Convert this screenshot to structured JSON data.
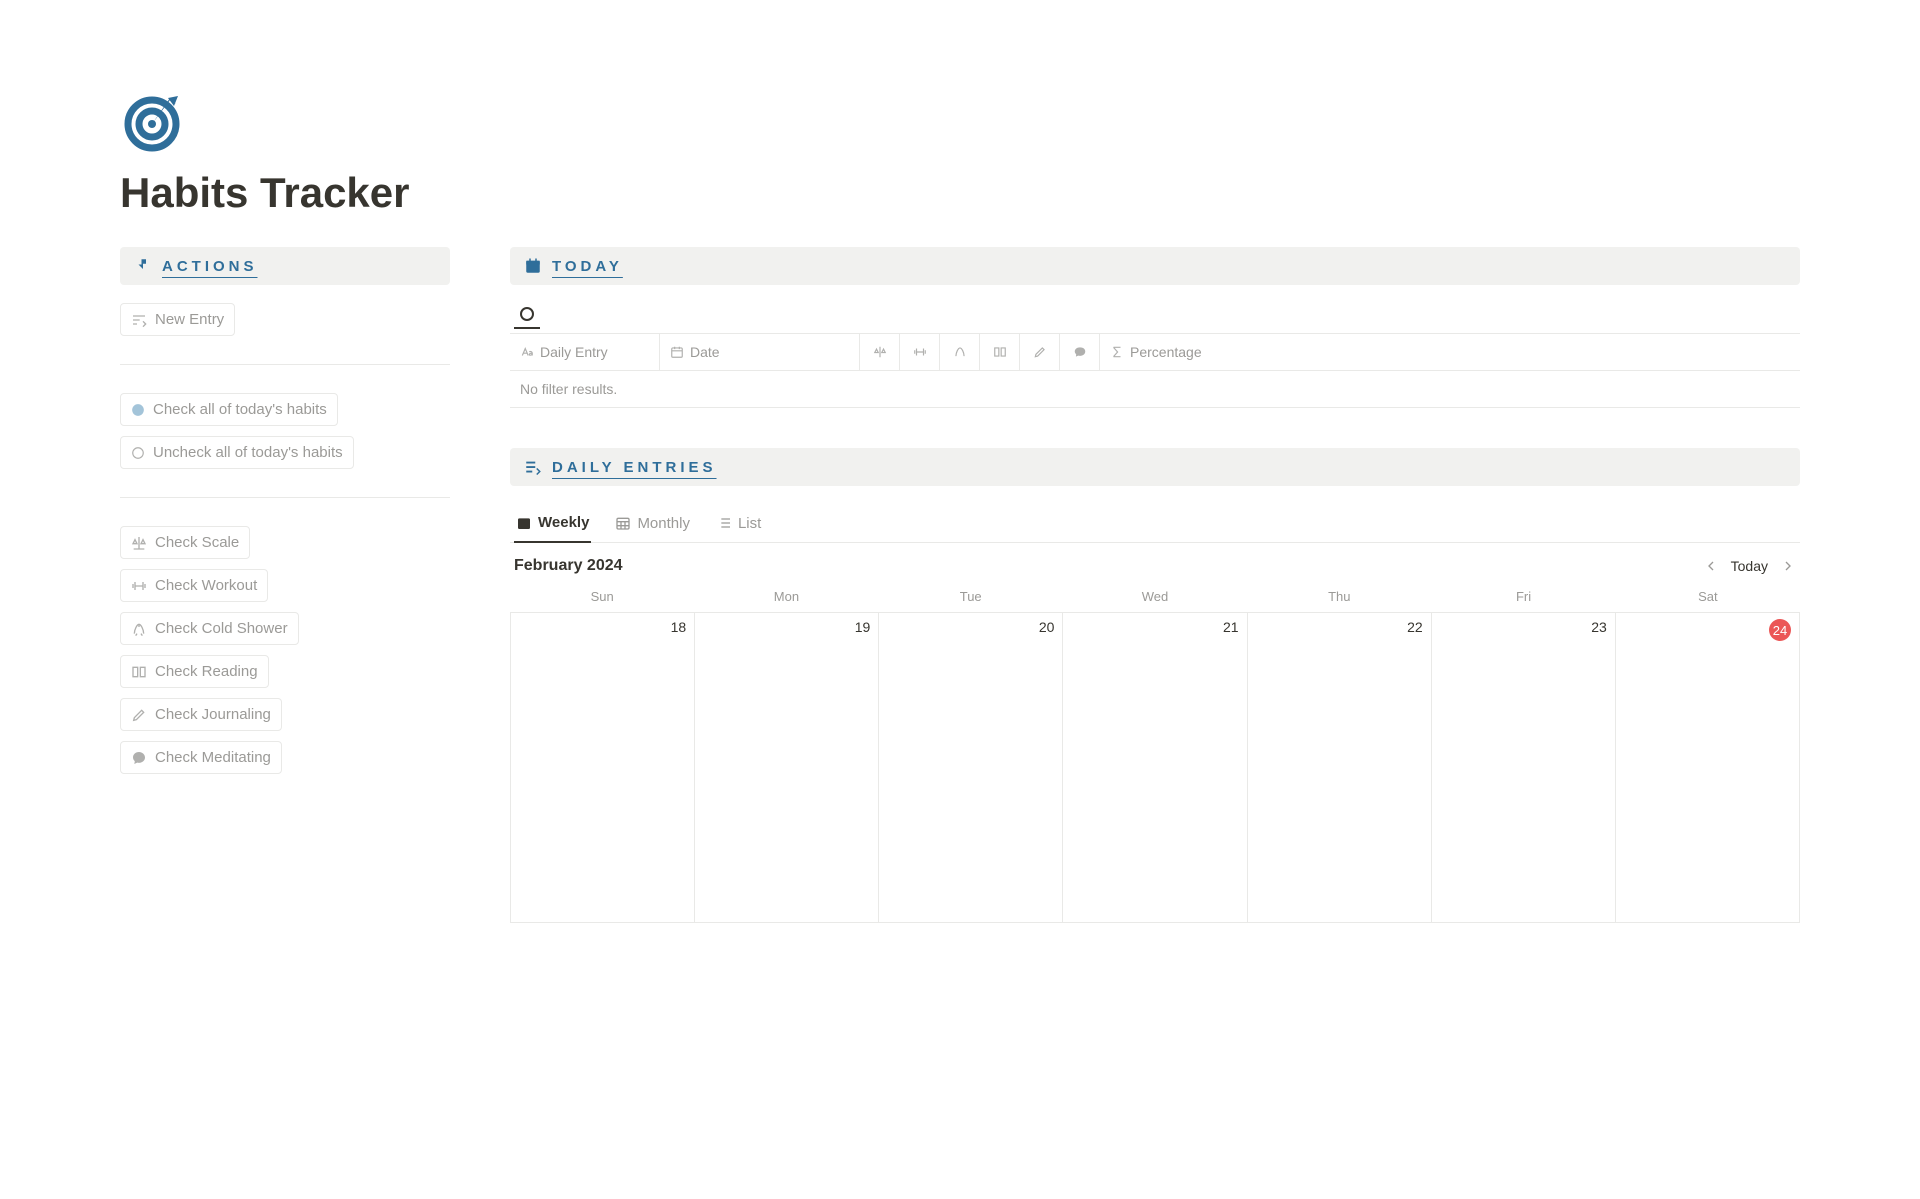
{
  "page": {
    "title": "Habits Tracker"
  },
  "actions": {
    "header": "ACTIONS",
    "new_entry": "New Entry",
    "check_all": "Check all of today's habits",
    "uncheck_all": "Uncheck all of today's habits",
    "habit_buttons": {
      "scale": "Check Scale",
      "workout": "Check Workout",
      "cold_shower": "Check Cold Shower",
      "reading": "Check Reading",
      "journaling": "Check Journaling",
      "meditating": "Check Meditating"
    }
  },
  "today": {
    "header": "TODAY",
    "columns": {
      "daily_entry": "Daily Entry",
      "date": "Date",
      "percentage": "Percentage"
    },
    "no_results": "No filter results."
  },
  "daily_entries": {
    "header": "DAILY ENTRIES",
    "tabs": {
      "weekly": "Weekly",
      "monthly": "Monthly",
      "list": "List"
    },
    "month_label": "February 2024",
    "today_label": "Today",
    "dow": {
      "sun": "Sun",
      "mon": "Mon",
      "tue": "Tue",
      "wed": "Wed",
      "thu": "Thu",
      "fri": "Fri",
      "sat": "Sat"
    },
    "dates": {
      "d0": "18",
      "d1": "19",
      "d2": "20",
      "d3": "21",
      "d4": "22",
      "d5": "23",
      "d6": "24"
    }
  }
}
